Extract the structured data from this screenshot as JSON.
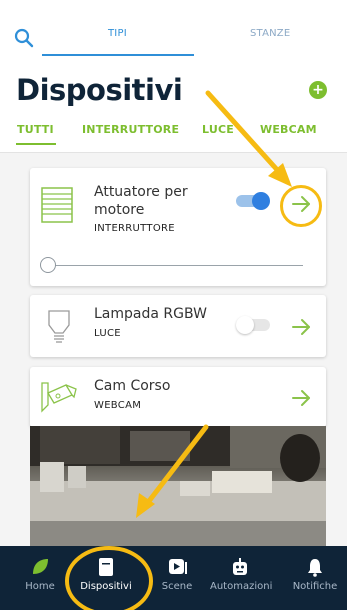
{
  "top_tabs": [
    {
      "label": "TIPI",
      "active": true
    },
    {
      "label": "STANZE",
      "active": false
    }
  ],
  "page": {
    "title": "Dispositivi",
    "add_icon": "plus-circle-icon"
  },
  "filters": [
    {
      "label": "TUTTI",
      "active": true
    },
    {
      "label": "INTERRUTTORE",
      "active": false
    },
    {
      "label": "LUCE",
      "active": false
    },
    {
      "label": "WEBCAM",
      "active": false
    }
  ],
  "devices": [
    {
      "title_line1": "Attuatore per",
      "title_line2": "motore",
      "type": "INTERRUTTORE",
      "toggle_on": true,
      "icon": "shutter-icon",
      "slider_level": 0
    },
    {
      "title_line1": "Lampada RGBW",
      "type": "LUCE",
      "toggle_on": false,
      "icon": "lightbulb-icon"
    },
    {
      "title_line1": "Cam Corso",
      "type": "WEBCAM",
      "icon": "camera-icon"
    }
  ],
  "bottom_nav": [
    {
      "label": "Home",
      "icon": "leaf-icon",
      "active": false
    },
    {
      "label": "Dispositivi",
      "icon": "device-icon",
      "active": true
    },
    {
      "label": "Scene",
      "icon": "play-icon",
      "active": false
    },
    {
      "label": "Automazioni",
      "icon": "robot-icon",
      "active": false
    },
    {
      "label": "Notifiche",
      "icon": "bell-icon",
      "active": false
    }
  ],
  "colors": {
    "accent_green": "#7dbe2f",
    "accent_blue": "#2f8fd8",
    "nav_background": "#0f2438",
    "annotation_yellow": "#f6bb13"
  }
}
